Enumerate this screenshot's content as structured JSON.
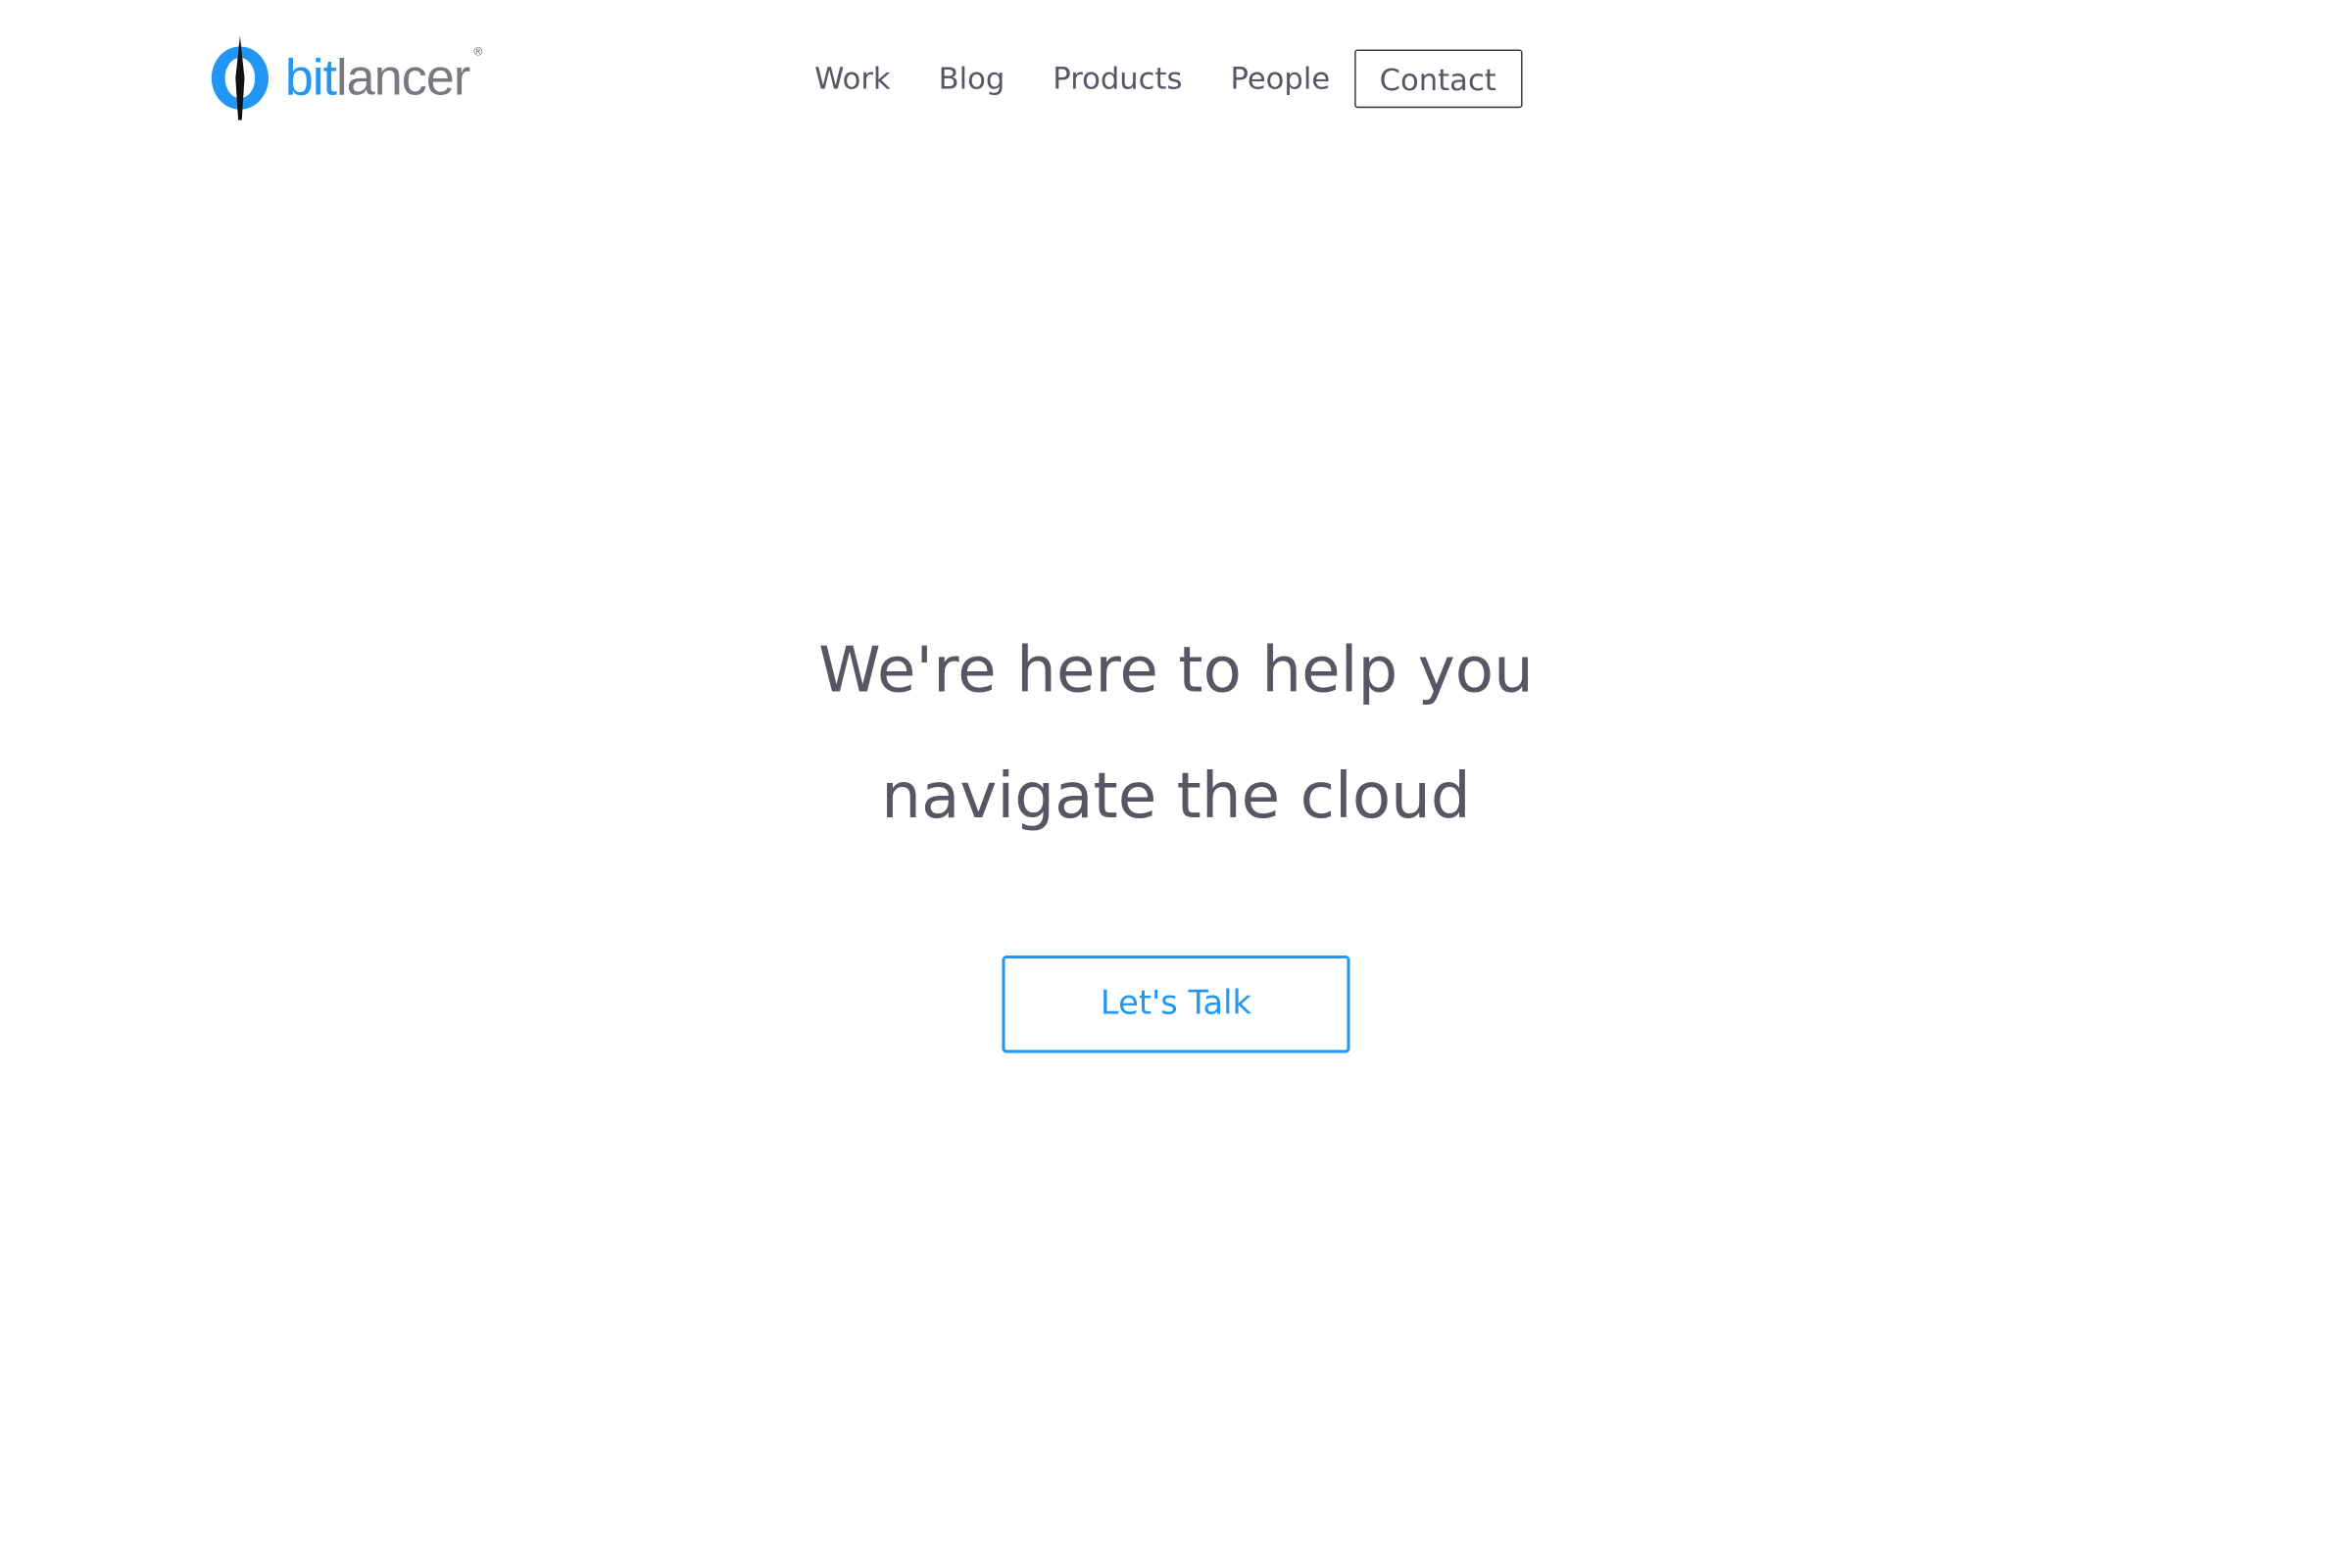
{
  "brand": {
    "name_part1": "bit",
    "name_part2": "lancer",
    "registered_mark": "®",
    "logo_icon": "compass-needle-logo-icon",
    "accent_color": "#2196f3",
    "text_color": "#77797e"
  },
  "nav": {
    "items": [
      {
        "label": "Work"
      },
      {
        "label": "Blog"
      },
      {
        "label": "Products"
      },
      {
        "label": "People"
      }
    ],
    "contact_label": "Contact"
  },
  "hero": {
    "line1": "We're here to help you",
    "line2": "navigate the cloud",
    "cta_label": "Let's Talk",
    "text_color": "#555763"
  }
}
